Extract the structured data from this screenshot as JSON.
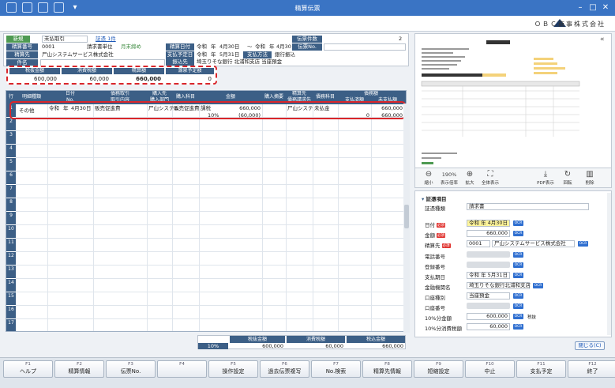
{
  "window": {
    "title": "精算伝票"
  },
  "company": {
    "name": "ＯＢＣ商事株式会社"
  },
  "header": {
    "shinki_label": "新規",
    "pay_type_value": "未払取引",
    "attach_link": "証憑 1件",
    "seisan_bango_label": "精算番号",
    "seisan_bango_value": "0001",
    "request_unit": "請求書単位",
    "month_end": "月末締め",
    "seisan_saki_label": "精算先",
    "seisan_saki_value": "尸山システムサービス株式会社",
    "kenmei_label": "件名",
    "seisan_date_label": "精算日付",
    "era1": "令和",
    "year1": "年",
    "date_from": "4月30日",
    "tilde": "～",
    "era2": "令和",
    "year2": "年",
    "date_to": "4月30日",
    "pay_date_label": "支払予定日",
    "era3": "令和",
    "year3": "年",
    "pay_date": "5月31日",
    "pay_method_label": "支払方法",
    "pay_method_value": "銀行振込",
    "furikomi_label": "振込先",
    "furikomi_value": "埼玉りそな銀行 北浦和支店 当座預金",
    "voucher_count_label": "伝票件数",
    "voucher_count_value": "2",
    "voucher_no_label": "伝票No."
  },
  "totals": {
    "h1": "税抜金額",
    "v1": "600,000",
    "h2": "消費税額",
    "v2": "60,000",
    "h3": "精算額",
    "v3": "660,000",
    "h4": "源泉予定額",
    "v4": "0"
  },
  "grid": {
    "headers": {
      "row": "行",
      "meisai": "明細種類",
      "date": "日付",
      "no": "No.",
      "torihiki": "債務取引",
      "kiyo": "取引内容",
      "buy_from": "購入先",
      "buy_dept": "購入部門",
      "kamoku": "購入科目",
      "amount": "金額",
      "tekiyo": "購入摘要",
      "seisan_saki": "精算先",
      "saimu_ukesaki": "債務請求先",
      "saimu_kamoku": "債務科目",
      "saimu_gaku": "債務額",
      "shiharai_zumi": "支払済額",
      "mi_shiharai": "未支払額"
    },
    "row1": {
      "num": "1",
      "meisai": "その他",
      "era": "令和",
      "year": "年",
      "date": "4月30日",
      "torihiki": "販売促進費",
      "buy_dept": "尸山システム",
      "kamoku": "販売促進費",
      "tax_label": "課税",
      "amount": "660,000",
      "tax_rate": "10%",
      "tax_amount": "(60,000)",
      "seisan_saki": "尸山システ",
      "saimu_kamoku": "未払金",
      "saimu_gaku": "660,000",
      "shiharai_zumi": "0",
      "mi_shiharai": "660,000"
    },
    "row_numbers": [
      "1",
      "2",
      "3",
      "4",
      "5",
      "6",
      "7",
      "8",
      "9",
      "10",
      "11",
      "12",
      "13",
      "14",
      "15",
      "16",
      "17"
    ]
  },
  "bottom_totals": {
    "h1": "税抜金額",
    "h2": "消費税額",
    "h3": "税込金額",
    "rate": "10%",
    "v1": "600,000",
    "v2": "60,000",
    "v3": "660,000"
  },
  "preview_toolbar": {
    "zoom": "190%",
    "shrink": "縮小",
    "fit": "表示倍率",
    "enlarge": "拡大",
    "whole": "全体表示",
    "pdf": "PDF表示",
    "rotate": "回転",
    "delete": "削除"
  },
  "details": {
    "section_title": "証憑項目",
    "doc_type_label": "証憑種類",
    "doc_type_value": "請求書",
    "req": "必須",
    "date_label": "日付",
    "date_era": "令和",
    "date_year": "年",
    "date_value": "4月30日",
    "amount_label": "金額",
    "amount_value": "660,000",
    "payee_label": "精算先",
    "payee_code": "0001",
    "payee_name": "尸山システムサービス株式会社",
    "phone_label": "電話番号",
    "reg_label": "登録番号",
    "pay_date_label": "支払期日",
    "pay_era": "令和",
    "pay_year": "年",
    "pay_date_value": "5月31日",
    "bank_label": "金融機関名",
    "bank_value": "埼玉りそな銀行北浦和支店",
    "acct_type_label": "口座種別",
    "acct_type_value": "当座預金",
    "acct_no_label": "口座番号",
    "amt10_label": "10%分金額",
    "amt10_value": "600,000",
    "tax10_label": "10%分消費税額",
    "tax10_value": "60,000",
    "tax_unit": "税抜",
    "ocr": "OCR",
    "close": "閉じる(C)"
  },
  "fkeys": [
    {
      "key": "F1",
      "label": "ヘルプ"
    },
    {
      "key": "F2",
      "label": "精算情報"
    },
    {
      "key": "F3",
      "label": "伝票No."
    },
    {
      "key": "F4",
      "label": ""
    },
    {
      "key": "F5",
      "label": "操作設定"
    },
    {
      "key": "F6",
      "label": "過去伝票複写"
    },
    {
      "key": "F7",
      "label": "No.検索"
    },
    {
      "key": "F8",
      "label": "精算先情報"
    },
    {
      "key": "F9",
      "label": "短縮設定"
    },
    {
      "key": "F10",
      "label": "中止"
    },
    {
      "key": "F11",
      "label": "支払予定"
    },
    {
      "key": "F12",
      "label": "終了"
    }
  ]
}
